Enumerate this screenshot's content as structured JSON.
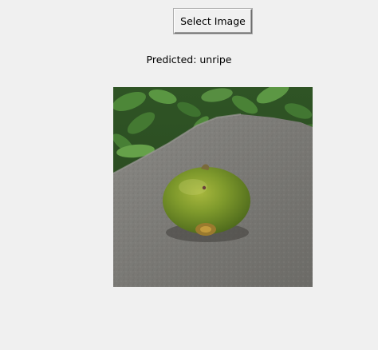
{
  "toolbar": {
    "select_label": "Select Image"
  },
  "result": {
    "prediction_text": "Predicted: unripe"
  },
  "image": {
    "alt": "Green unripe fruit resting on a gray stone with leafy plants behind",
    "colors": {
      "leaves": "#3d6b2c",
      "rock": "#7d7c78",
      "fruit": "#7d9a2e"
    }
  }
}
